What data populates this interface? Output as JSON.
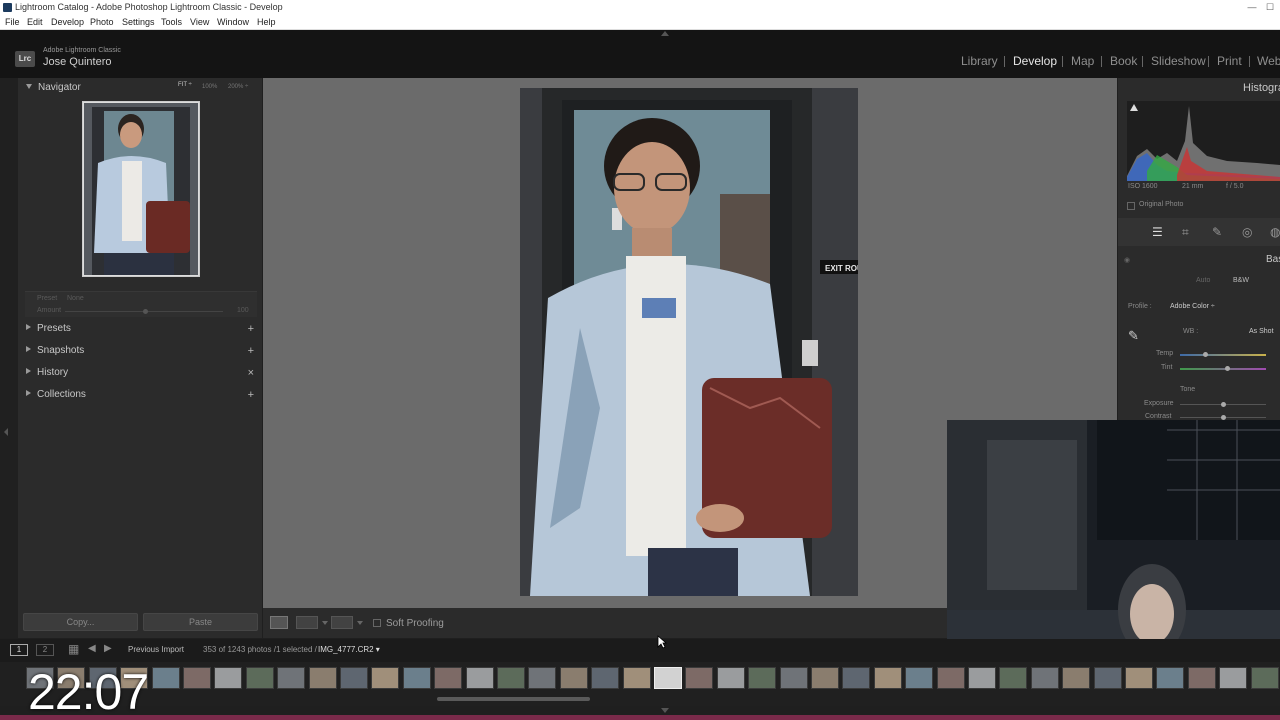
{
  "window": {
    "title": "Lightroom Catalog - Adobe Photoshop Lightroom Classic - Develop",
    "controls": [
      "—",
      "☐",
      "✕"
    ]
  },
  "menu": [
    "File",
    "Edit",
    "Develop",
    "Photo",
    "Settings",
    "Tools",
    "View",
    "Window",
    "Help"
  ],
  "identity": {
    "logo": "Lrc",
    "product": "Adobe Lightroom Classic",
    "user": "Jose Quintero"
  },
  "modules": [
    "Library",
    "Develop",
    "Map",
    "Book",
    "Slideshow",
    "Print",
    "Web"
  ],
  "active_module": "Develop",
  "left_panel": {
    "navigator": {
      "title": "Navigator",
      "zoom_fit": "FIT ÷",
      "zoom_100": "100%",
      "zoom_200": "200% ÷"
    },
    "preset_row": {
      "label": "Preset",
      "value": "None",
      "amount_label": "Amount",
      "amount_value": "100"
    },
    "sections": [
      {
        "label": "Presets",
        "action": "+"
      },
      {
        "label": "Snapshots",
        "action": "+"
      },
      {
        "label": "History",
        "action": "×"
      },
      {
        "label": "Collections",
        "action": "+"
      }
    ],
    "copy_label": "Copy...",
    "paste_label": "Paste"
  },
  "photo": {
    "sign": "EXIT ROU"
  },
  "toolbar": {
    "soft_proofing": "Soft Proofing"
  },
  "right_panel": {
    "histogram_title": "Histogra",
    "iso": "ISO 1600",
    "focal": "21 mm",
    "aperture": "f / 5.0",
    "original_photo": "Original Photo",
    "basic_title": "Bas",
    "auto": "Auto",
    "bw": "B&W",
    "profile_label": "Profile :",
    "profile_value": "Adobe Color ÷",
    "wb_label": "WB :",
    "wb_value": "As Shot",
    "temp": "Temp",
    "tint": "Tint",
    "tone": "Tone",
    "exposure": "Exposure",
    "contrast": "Contrast"
  },
  "filmbar": {
    "view1": "1",
    "view2": "2",
    "source": "Previous Import",
    "count": "353 of 1243 photos /1 selected /",
    "filename": "IMG_4777.CR2 ▾"
  },
  "overlay_clock": "22:07"
}
